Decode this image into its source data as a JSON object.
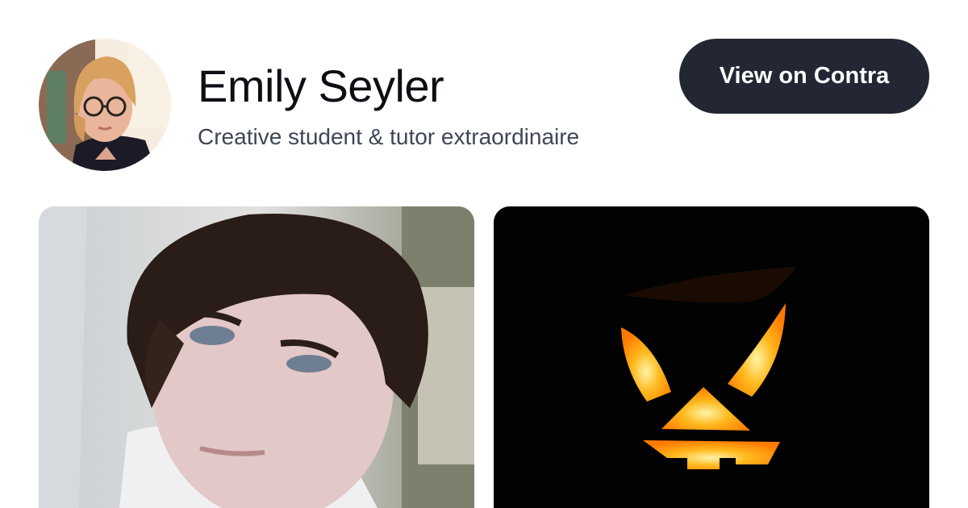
{
  "profile": {
    "name": "Emily Seyler",
    "tagline": "Creative student & tutor extraordinaire",
    "avatar_icon": "profile-photo"
  },
  "cta": {
    "label": "View on Contra"
  },
  "portfolio": {
    "items": [
      {
        "icon": "portrait-photo"
      },
      {
        "icon": "jack-o-lantern-photo"
      }
    ]
  },
  "colors": {
    "cta_background": "#222733",
    "name_text": "#0d0f14",
    "tagline_text": "#3f4656",
    "pumpkin_glow": "#ff9a12"
  }
}
